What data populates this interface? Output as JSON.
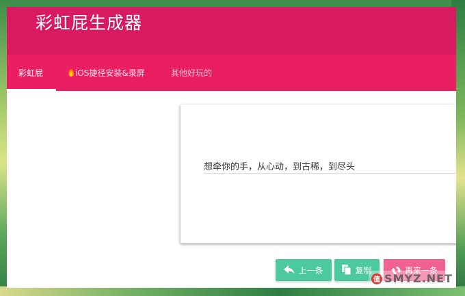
{
  "app": {
    "title": "彩虹屁生成器"
  },
  "tabs": [
    {
      "label": "彩虹屁",
      "active": true
    },
    {
      "label": "iOS捷径安装&录屏",
      "icon": "flame-icon"
    },
    {
      "label": "其他好玩的"
    }
  ],
  "quote": {
    "text": "想牵你的手，从心动，到古稀，到尽头"
  },
  "buttons": {
    "prev_label": "上一条",
    "copy_label": "复制",
    "next_label": "再来一条"
  },
  "watermark": {
    "text": "SMYZ.NET"
  },
  "colors": {
    "header": "#d81b60",
    "tabs": "#e91e63",
    "primary_button": "#4dc9a0",
    "accent_button": "#f06292"
  }
}
